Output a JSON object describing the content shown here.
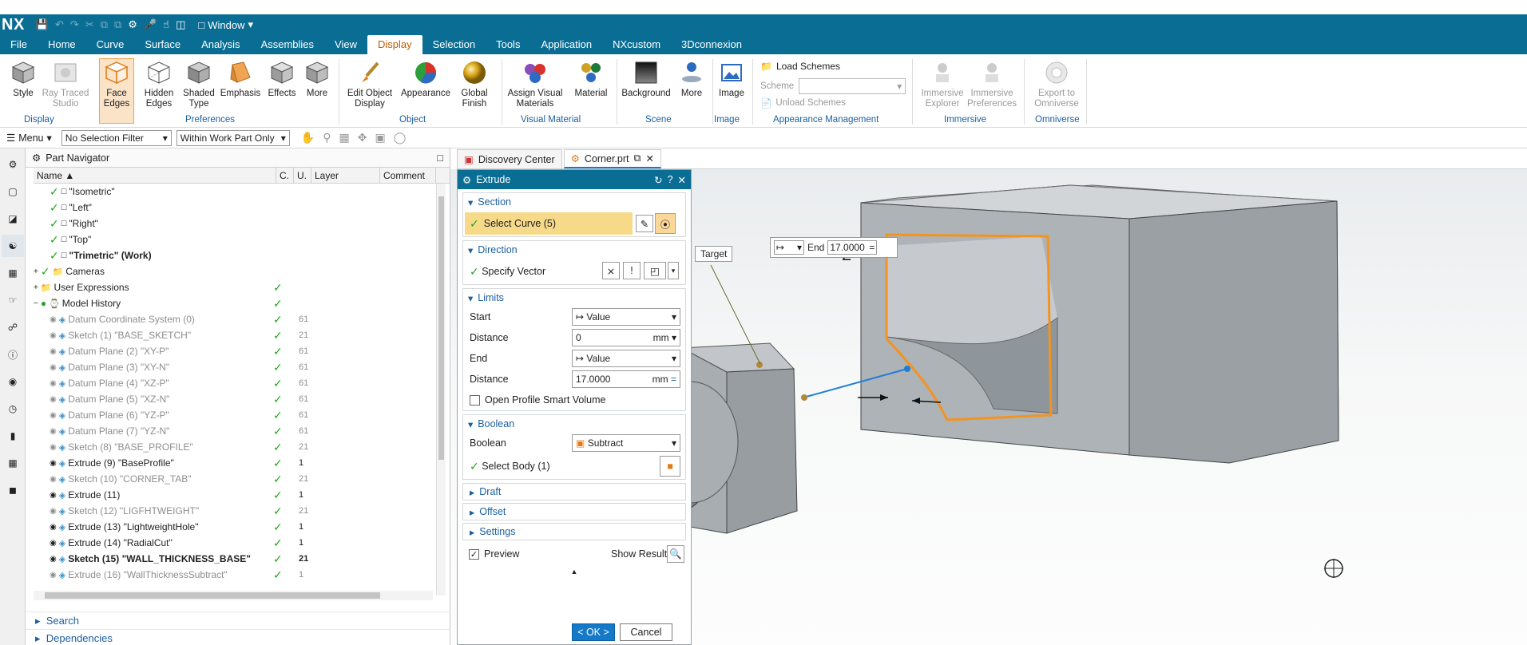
{
  "app": {
    "logo": "NX",
    "window_menu": "Window"
  },
  "menu": {
    "items": [
      "File",
      "Home",
      "Curve",
      "Surface",
      "Analysis",
      "Assemblies",
      "View",
      "Display",
      "Selection",
      "Tools",
      "Application",
      "NXcustom",
      "3Dconnexion"
    ],
    "active": "Display"
  },
  "ribbon": {
    "style": "Style",
    "ray_traced": "Ray Traced Studio",
    "face_edges": "Face Edges",
    "hidden_edges": "Hidden Edges",
    "shaded_type": "Shaded Type",
    "emphasis": "Emphasis",
    "effects": "Effects",
    "more1": "More",
    "edit_object_display": "Edit Object Display",
    "appearance": "Appearance",
    "global_finish": "Global Finish",
    "assign_visual": "Assign Visual Materials",
    "material": "Material",
    "background": "Background",
    "more2": "More",
    "image": "Image",
    "load_schemes": "Load Schemes",
    "scheme": "Scheme",
    "unload_schemes": "Unload Schemes",
    "immersive_explorer": "Immersive Explorer",
    "immersive_preferences": "Immersive Preferences",
    "export_omniverse": "Export to Omniverse",
    "groups": {
      "display": "Display",
      "preferences": "Preferences",
      "object": "Object",
      "visual_material": "Visual Material",
      "scene": "Scene",
      "image": "Image",
      "appearance_management": "Appearance Management",
      "immersive": "Immersive",
      "omniverse": "Omniverse"
    }
  },
  "selbar": {
    "menu": "Menu",
    "filter": "No Selection Filter",
    "scope": "Within Work Part Only"
  },
  "navigator": {
    "title": "Part Navigator",
    "columns": {
      "name": "Name",
      "c": "C.",
      "u": "U.",
      "layer": "Layer",
      "comment": "Comment"
    },
    "rows": [
      {
        "name": "\"Isometric\"",
        "check": true,
        "layer": "",
        "state": "view"
      },
      {
        "name": "\"Left\"",
        "check": true,
        "layer": "",
        "state": "view"
      },
      {
        "name": "\"Right\"",
        "check": true,
        "layer": "",
        "state": "view"
      },
      {
        "name": "\"Top\"",
        "check": true,
        "layer": "",
        "state": "view"
      },
      {
        "name": "\"Trimetric\" (Work)",
        "check": true,
        "layer": "",
        "state": "view-bold"
      },
      {
        "name": "Cameras",
        "check": true,
        "layer": "",
        "state": "folder"
      },
      {
        "name": "User Expressions",
        "check": false,
        "layer": "",
        "state": "folder-u"
      },
      {
        "name": "Model History",
        "check": false,
        "layer": "",
        "state": "history"
      },
      {
        "name": "Datum Coordinate System (0)",
        "layer": "61",
        "state": "grey"
      },
      {
        "name": "Sketch (1) \"BASE_SKETCH\"",
        "layer": "21",
        "state": "grey"
      },
      {
        "name": "Datum Plane (2) \"XY-P\"",
        "layer": "61",
        "state": "grey"
      },
      {
        "name": "Datum Plane (3) \"XY-N\"",
        "layer": "61",
        "state": "grey"
      },
      {
        "name": "Datum Plane (4) \"XZ-P\"",
        "layer": "61",
        "state": "grey"
      },
      {
        "name": "Datum Plane (5) \"XZ-N\"",
        "layer": "61",
        "state": "grey"
      },
      {
        "name": "Datum Plane (6) \"YZ-P\"",
        "layer": "61",
        "state": "grey"
      },
      {
        "name": "Datum Plane (7) \"YZ-N\"",
        "layer": "61",
        "state": "grey"
      },
      {
        "name": "Sketch (8) \"BASE_PROFILE\"",
        "layer": "21",
        "state": "grey"
      },
      {
        "name": "Extrude (9) \"BaseProfile\"",
        "layer": "1",
        "state": "normal"
      },
      {
        "name": "Sketch (10) \"CORNER_TAB\"",
        "layer": "21",
        "state": "grey"
      },
      {
        "name": "Extrude (11)",
        "layer": "1",
        "state": "normal"
      },
      {
        "name": "Sketch (12) \"LIGFHTWEIGHT\"",
        "layer": "21",
        "state": "grey"
      },
      {
        "name": "Extrude (13) \"LightweightHole\"",
        "layer": "1",
        "state": "normal"
      },
      {
        "name": "Extrude (14) \"RadialCut\"",
        "layer": "1",
        "state": "normal"
      },
      {
        "name": "Sketch (15) \"WALL_THICKNESS_BASE\"",
        "layer": "21",
        "state": "bold"
      },
      {
        "name": "Extrude (16) \"WallThicknessSubtract\"",
        "layer": "1",
        "state": "grey"
      }
    ],
    "search": "Search",
    "dependencies": "Dependencies"
  },
  "tabs": {
    "discovery": "Discovery Center",
    "part": "Corner.prt"
  },
  "dialog": {
    "title": "Extrude",
    "section": "Section",
    "select_curve": "Select Curve (5)",
    "direction": "Direction",
    "specify_vector": "Specify Vector",
    "limits": "Limits",
    "start_label": "Start",
    "start_value": "Value",
    "distance_label": "Distance",
    "distance1": "0",
    "unit1": "mm",
    "end_label": "End",
    "end_value": "Value",
    "distance2": "17.0000",
    "unit2": "mm",
    "open_profile": "Open Profile Smart Volume",
    "boolean_section": "Boolean",
    "boolean_label": "Boolean",
    "boolean_value": "Subtract",
    "select_body": "Select Body (1)",
    "draft": "Draft",
    "offset": "Offset",
    "settings": "Settings",
    "preview": "Preview",
    "show_result": "Show Result",
    "ok": "< OK >",
    "cancel": "Cancel"
  },
  "viewport": {
    "target_label": "Target",
    "end_label": "End",
    "end_value": "17.0000",
    "dim": "2"
  }
}
